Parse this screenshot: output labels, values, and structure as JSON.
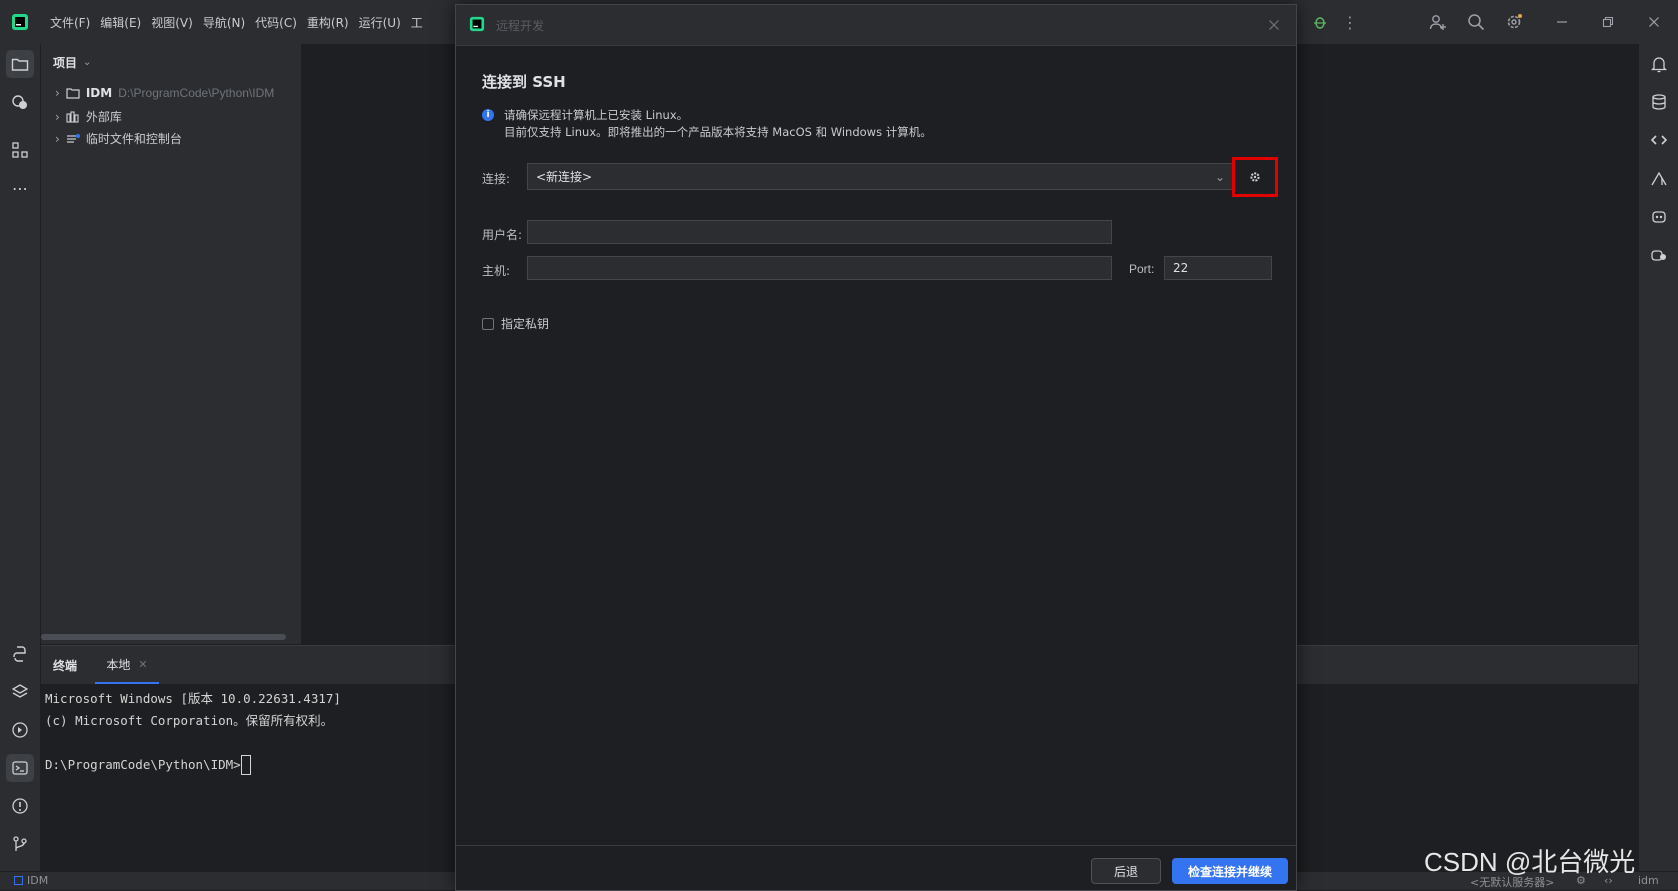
{
  "menu": [
    "文件(F)",
    "编辑(E)",
    "视图(V)",
    "导航(N)",
    "代码(C)",
    "重构(R)",
    "运行(U)",
    "工"
  ],
  "project": {
    "header": "项目",
    "tree": [
      {
        "name": "IDM",
        "path": "D:\\ProgramCode\\Python\\IDM"
      },
      {
        "name": "外部库",
        "path": ""
      },
      {
        "name": "临时文件和控制台",
        "path": ""
      }
    ]
  },
  "terminal": {
    "tab_title": "终端",
    "tab_local": "本地",
    "lines": [
      "Microsoft Windows [版本 10.0.22631.4317]",
      "(c) Microsoft Corporation。保留所有权利。",
      "",
      "D:\\ProgramCode\\Python\\IDM>"
    ]
  },
  "dialog": {
    "title": "远程开发",
    "heading": "连接到 SSH",
    "info_line1": "请确保远程计算机上已安装 Linux。",
    "info_line2": "目前仅支持 Linux。即将推出的一个产品版本将支持 MacOS 和 Windows 计算机。",
    "connection_label": "连接:",
    "connection_value": "<新连接>",
    "username_label": "用户名:",
    "username_value": "",
    "host_label": "主机:",
    "host_value": "",
    "port_label": "Port:",
    "port_value": "22",
    "private_key_label": "指定私钥",
    "back_button": "后退",
    "continue_button": "检查连接并继续"
  },
  "status": {
    "project": "IDM",
    "server": "<无默认服务器>",
    "interpreter": "idm"
  },
  "watermark": "CSDN @北台微光",
  "colors": {
    "accent": "#3574f0",
    "highlight": "#e00000",
    "info": "#3574f0"
  }
}
